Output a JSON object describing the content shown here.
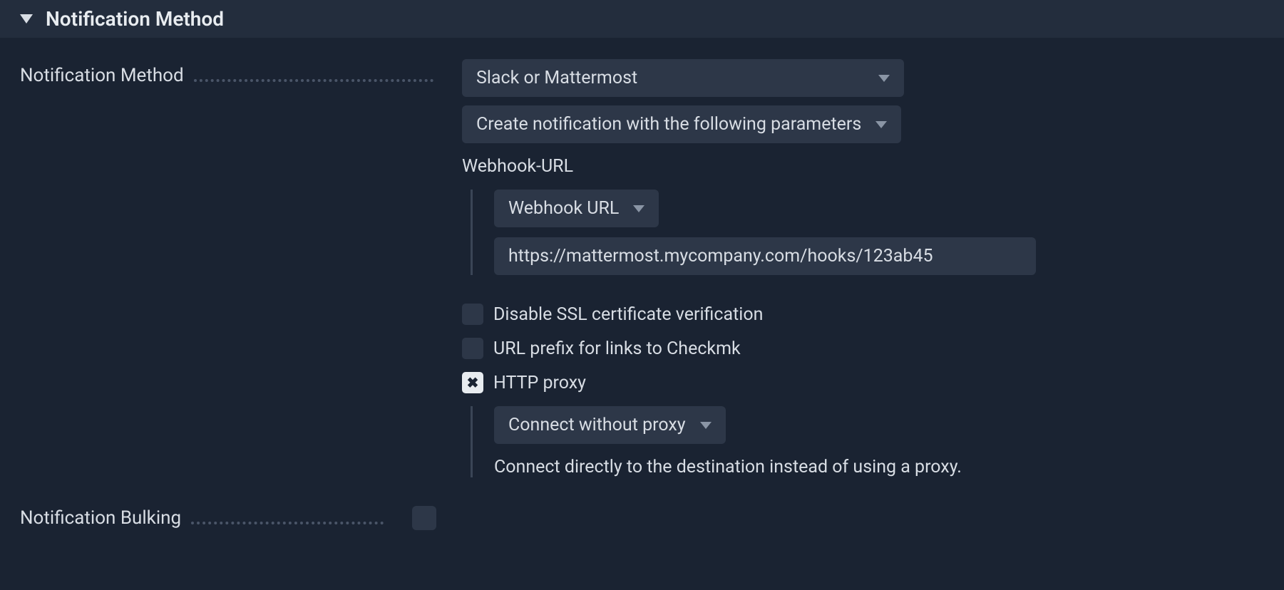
{
  "section": {
    "title": "Notification Method"
  },
  "form": {
    "method_label": "Notification Method",
    "method_select": "Slack or Mattermost",
    "params_select": "Create notification with the following parameters",
    "webhook_section_label": "Webhook-URL",
    "webhook_url_select": "Webhook URL",
    "webhook_url_value": "https://mattermost.mycompany.com/hooks/123ab45",
    "checkbox_ssl": "Disable SSL certificate verification",
    "checkbox_url_prefix": "URL prefix for links to Checkmk",
    "checkbox_http_proxy": "HTTP proxy",
    "proxy_select": "Connect without proxy",
    "proxy_description": "Connect directly to the destination instead of using a proxy.",
    "bulking_label": "Notification Bulking"
  }
}
